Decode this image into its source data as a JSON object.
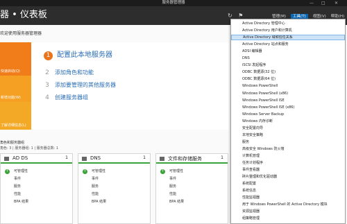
{
  "titlebar": {
    "title": "服务器管理器",
    "minimize": "—",
    "maximize": "□",
    "close": "✕"
  },
  "header": {
    "breadcrumb": "器 • 仪表板",
    "refresh_glyph": "↻",
    "notify_glyph": "⚑",
    "menus": [
      {
        "label": "管理(M)",
        "active": false
      },
      {
        "label": "工具(T)",
        "active": true
      },
      {
        "label": "视图(V)",
        "active": false
      },
      {
        "label": "帮助(H)",
        "active": false
      }
    ]
  },
  "welcome": {
    "title": "欢迎使用服务器管理器"
  },
  "quickstart": {
    "items": [
      {
        "label": "快速启动(Q)",
        "color": "#f07c1a"
      },
      {
        "label": "新增功能(W)",
        "color": "#f5a023"
      },
      {
        "label": "了解详细信息(L)",
        "color": "#f3a826"
      }
    ]
  },
  "tasks": [
    {
      "num": "1",
      "label": "配置此本地服务器"
    },
    {
      "num": "2",
      "label": "添加角色和功能"
    },
    {
      "num": "3",
      "label": "添加要管理的其他服务器"
    },
    {
      "num": "4",
      "label": "创建服务器组"
    }
  ],
  "roles": {
    "title": "角色和服务器组",
    "subtitle": "角色: 3 | 服务器组: 1 | 服务器总数: 1",
    "tiles": [
      {
        "name": "AD DS",
        "count": "1",
        "rows": [
          "可管理性",
          "事件",
          "服务",
          "性能",
          "BPA 结果"
        ]
      },
      {
        "name": "DNS",
        "count": "1",
        "rows": [
          "可管理性",
          "事件",
          "服务",
          "性能",
          "BPA 结果"
        ]
      },
      {
        "name": "文件和存储服务",
        "count": "1",
        "rows": [
          "可管理性",
          "事件",
          "服务",
          "性能",
          "BPA 结果"
        ]
      }
    ]
  },
  "tools_menu": {
    "highlighted_index": 2,
    "items": [
      "Active Directory 管理中心",
      "Active Directory 用户和计算机",
      "Active Directory 域和信任关系",
      "Active Directory 站点和服务",
      "ADSI 编辑器",
      "DNS",
      "iSCSI 发起程序",
      "ODBC 数据源(32 位)",
      "ODBC 数据源(64 位)",
      "Windows PowerShell",
      "Windows PowerShell (x86)",
      "Windows PowerShell ISE",
      "Windows PowerShell ISE (x86)",
      "Windows Server Backup",
      "Windows 内存诊断",
      "安全配置向导",
      "本地安全策略",
      "服务",
      "高级安全 Windows 防火墙",
      "计算机管理",
      "任务计划程序",
      "事件查看器",
      "碎片整理和优化驱动器",
      "系统配置",
      "系统信息",
      "性能监视器",
      "用于 Windows PowerShell 的 Active Directory 模块",
      "资源监视器",
      "组策略管理"
    ]
  }
}
